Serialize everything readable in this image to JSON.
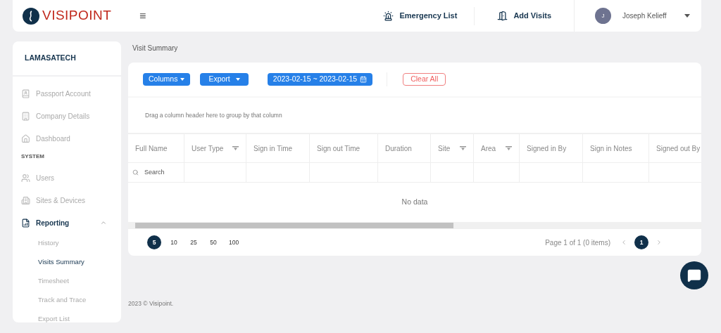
{
  "header": {
    "logo": "VISIPOINT",
    "menu_icon": "≡",
    "emergency": "Emergency List",
    "add_visits": "Add Visits",
    "user": {
      "initial": "J",
      "name": "Joseph Kelieff"
    }
  },
  "sidebar": {
    "org": "LAMASATECH",
    "items": [
      {
        "kind": "item",
        "label": "Passport Account",
        "selected": false
      },
      {
        "kind": "item",
        "label": "Company Details",
        "selected": false
      },
      {
        "kind": "item",
        "label": "Dashboard",
        "selected": false
      },
      {
        "kind": "section",
        "label": "SYSTEM"
      },
      {
        "kind": "item",
        "label": "Users",
        "selected": false
      },
      {
        "kind": "item",
        "label": "Sites & Devices",
        "selected": false
      },
      {
        "kind": "item",
        "label": "Reporting",
        "selected": true,
        "expanded": true,
        "children": [
          {
            "label": "History",
            "selected": false
          },
          {
            "label": "Visits Summary",
            "selected": true
          },
          {
            "label": "Timesheet",
            "selected": false
          },
          {
            "label": "Track and Trace",
            "selected": false
          },
          {
            "label": "Export List",
            "selected": false
          }
        ]
      }
    ]
  },
  "page_title": "Visit Summary",
  "toolbar": {
    "columns": "Columns",
    "export": "Export",
    "date_range": "2023-02-15 ~ 2023-02-15",
    "clear": "Clear All"
  },
  "group_hint": "Drag a column header here to group by that column",
  "table": {
    "columns": [
      {
        "label": "Full Name",
        "filter": false
      },
      {
        "label": "User Type",
        "filter": true
      },
      {
        "label": "Sign in Time",
        "filter": false
      },
      {
        "label": "Sign out Time",
        "filter": false
      },
      {
        "label": "Duration",
        "filter": false
      },
      {
        "label": "Site",
        "filter": true
      },
      {
        "label": "Area",
        "filter": true
      },
      {
        "label": "Signed in By",
        "filter": false
      },
      {
        "label": "Sign in Notes",
        "filter": false
      },
      {
        "label": "Signed out By"
      }
    ],
    "search_placeholder": "Search",
    "empty": "No data"
  },
  "pager": {
    "sizes": [
      {
        "label": "5",
        "selected": true
      },
      {
        "label": "10",
        "selected": false
      },
      {
        "label": "25",
        "selected": false
      },
      {
        "label": "50",
        "selected": false
      },
      {
        "label": "100",
        "selected": false
      }
    ],
    "info": "Page 1 of 1 (0 items)",
    "pages": [
      {
        "label": "1",
        "selected": true
      }
    ]
  },
  "footer": "2023 © Visipoint."
}
